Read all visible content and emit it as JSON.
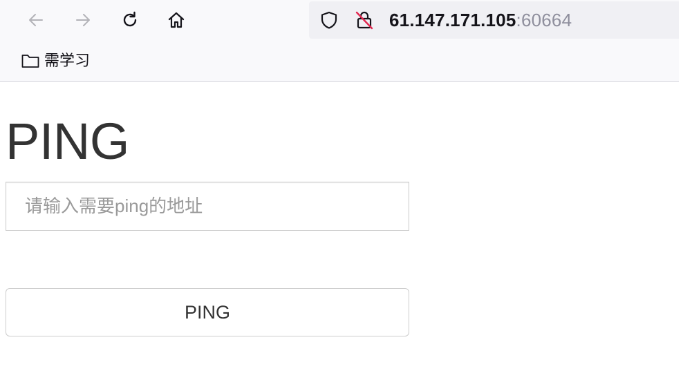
{
  "browser": {
    "url": {
      "host": "61.147.171.105",
      "port": ":60664"
    },
    "bookmarks": [
      {
        "label": "需学习"
      }
    ]
  },
  "page": {
    "title": "PING",
    "address_input": {
      "value": "",
      "placeholder": "请输入需要ping的地址"
    },
    "ping_button_label": "PING"
  }
}
